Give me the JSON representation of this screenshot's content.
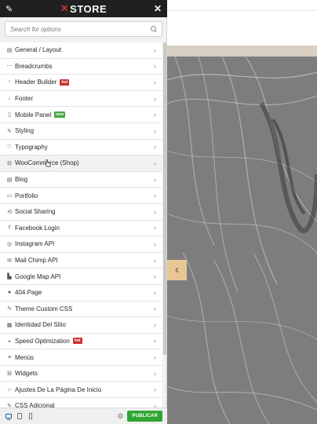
{
  "header": {
    "brand_mark": "✕",
    "brand_name": "STORE",
    "pin_icon": "pin-icon",
    "close_icon": "close-icon"
  },
  "search": {
    "placeholder": "Search for options",
    "icon": "search-icon"
  },
  "menu": [
    {
      "label": "General / Layout",
      "icon": "layout-icon",
      "glyph": "▤"
    },
    {
      "label": "Breadcrumbs",
      "icon": "breadcrumbs-icon",
      "glyph": "⋯"
    },
    {
      "label": "Header Builder",
      "icon": "arrow-up-icon",
      "glyph": "↑",
      "badge": "hot",
      "badge_type": "hot"
    },
    {
      "label": "Footer",
      "icon": "arrow-down-icon",
      "glyph": "↓"
    },
    {
      "label": "Mobile Panel",
      "icon": "mobile-icon",
      "glyph": "▯",
      "badge": "New",
      "badge_type": "new"
    },
    {
      "label": "Styling",
      "icon": "brush-icon",
      "glyph": "✎"
    },
    {
      "label": "Typography",
      "icon": "typography-icon",
      "glyph": "♡"
    },
    {
      "label": "WooCommerce (Shop)",
      "icon": "cart-icon",
      "glyph": "⊟",
      "hovered": true
    },
    {
      "label": "Blog",
      "icon": "blog-icon",
      "glyph": "▤"
    },
    {
      "label": "Portfolio",
      "icon": "portfolio-icon",
      "glyph": "▭"
    },
    {
      "label": "Social Sharing",
      "icon": "share-icon",
      "glyph": "⟲"
    },
    {
      "label": "Facebook Login",
      "icon": "facebook-icon",
      "glyph": "f"
    },
    {
      "label": "Instagram API",
      "icon": "instagram-icon",
      "glyph": "◎"
    },
    {
      "label": "Mail Chimp API",
      "icon": "mail-icon",
      "glyph": "✉"
    },
    {
      "label": "Google Map API",
      "icon": "map-icon",
      "glyph": "▙"
    },
    {
      "label": "404 Page",
      "icon": "info-icon",
      "glyph": "●"
    },
    {
      "label": "Theme Custom CSS",
      "icon": "css-brush-icon",
      "glyph": "✎"
    },
    {
      "label": "Identidad Del Sitio",
      "icon": "site-identity-icon",
      "glyph": "▦"
    },
    {
      "label": "Speed Optimization",
      "icon": "speed-icon",
      "glyph": "◒",
      "badge": "hot",
      "badge_type": "hot"
    },
    {
      "label": "Menús",
      "icon": "menus-icon",
      "glyph": "≡"
    },
    {
      "label": "Widgets",
      "icon": "wordpress-icon",
      "glyph": "Ⓦ"
    },
    {
      "label": "Ajustes De La Página De Inicio",
      "icon": "home-icon",
      "glyph": "⌂"
    },
    {
      "label": "CSS Adicional",
      "icon": "css-icon",
      "glyph": "✎"
    }
  ],
  "footer": {
    "devices": [
      "desktop-icon",
      "tablet-icon",
      "mobile-device-icon"
    ],
    "settings_icon": "gear-icon",
    "publish_label": "PUBLICAR"
  },
  "preview": {
    "arrow_glyph": "‹",
    "colors": {
      "band": "#d8d0c3",
      "arrow_bg": "#e8c795"
    }
  },
  "colors": {
    "header_bg": "#202020",
    "brand_accent": "#c9302c",
    "publish_bg": "#2ea632",
    "badge_hot": "#c9302c",
    "badge_new": "#46a546"
  }
}
